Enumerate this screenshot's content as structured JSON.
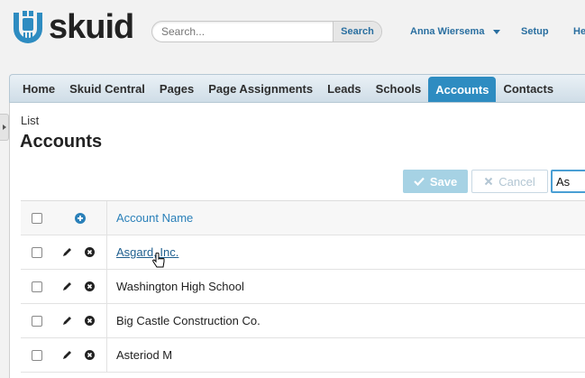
{
  "header": {
    "logo_text": "skuid",
    "search_placeholder": "Search...",
    "search_button": "Search",
    "user_name": "Anna Wiersema",
    "setup": "Setup",
    "help": "He"
  },
  "tabs": [
    {
      "label": "Home"
    },
    {
      "label": "Skuid Central"
    },
    {
      "label": "Pages"
    },
    {
      "label": "Page Assignments"
    },
    {
      "label": "Leads"
    },
    {
      "label": "Schools"
    },
    {
      "label": "Accounts",
      "active": true
    },
    {
      "label": "Contacts"
    }
  ],
  "page": {
    "breadcrumb": "List",
    "title": "Accounts"
  },
  "toolbar": {
    "save_label": "Save",
    "cancel_label": "Cancel",
    "filter_value": "As"
  },
  "table": {
    "header": {
      "name": "Account Name"
    },
    "rows": [
      {
        "name": "Asgard, Inc."
      },
      {
        "name": "Washington High School"
      },
      {
        "name": "Big Castle Construction Co."
      },
      {
        "name": "Asteriod M"
      }
    ]
  },
  "colors": {
    "brand": "#2e8cc1",
    "link": "#1f5f8f",
    "save_disabled": "#a6d2e4"
  }
}
